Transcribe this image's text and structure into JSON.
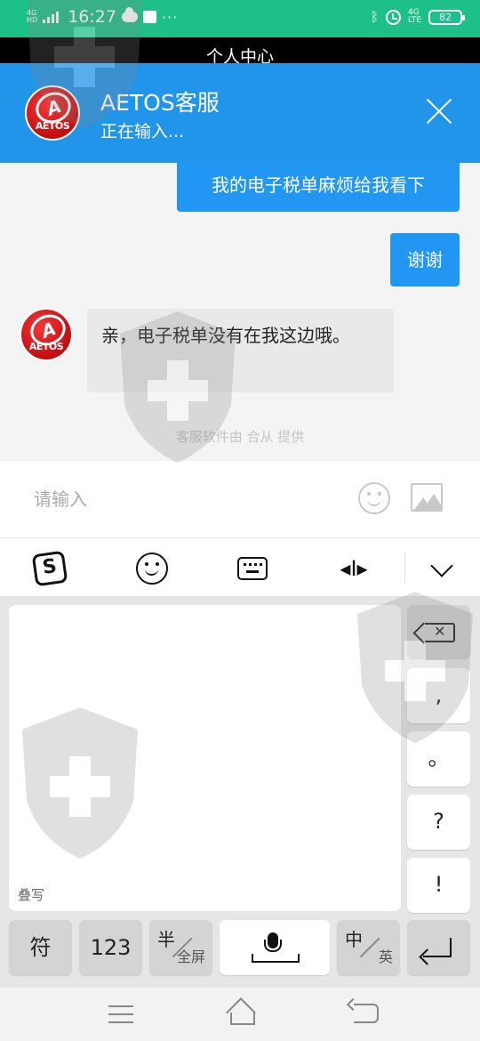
{
  "status_bar": {
    "network": "4G",
    "network_sub": "HD",
    "time": "16:27",
    "dots": "···",
    "lte": "4G",
    "lte_sub": "LTE",
    "battery": "82",
    "color": "#1ec08a"
  },
  "page_title": "个人中心",
  "chat_header": {
    "agent_name": "AETOS客服",
    "agent_status": "正在输入...",
    "logo_text": "AETOS",
    "color": "#2195e9"
  },
  "messages": [
    {
      "from": "user",
      "text": "我的电子税单麻烦给我看下"
    },
    {
      "from": "user",
      "text": "谢谢"
    },
    {
      "from": "agent",
      "text": "亲，电子税单没有在我这边哦。"
    }
  ],
  "powered_by": "客服软件由 合从 提供",
  "input": {
    "placeholder": "请输入",
    "value": ""
  },
  "keyboard": {
    "toolbar_icons": [
      "sogou-icon",
      "smile-icon",
      "keyboard-icon",
      "cursor-move-icon",
      "collapse-icon"
    ],
    "handwrite_label": "叠写",
    "punct": [
      ",",
      "。",
      "?",
      "!"
    ],
    "symbol": "符",
    "num": "123",
    "halfwidth_big": "半",
    "halfwidth_small": "全屏",
    "lang_big": "中",
    "lang_small": "英"
  },
  "nav_icons": [
    "menu-icon",
    "home-icon",
    "back-icon"
  ]
}
